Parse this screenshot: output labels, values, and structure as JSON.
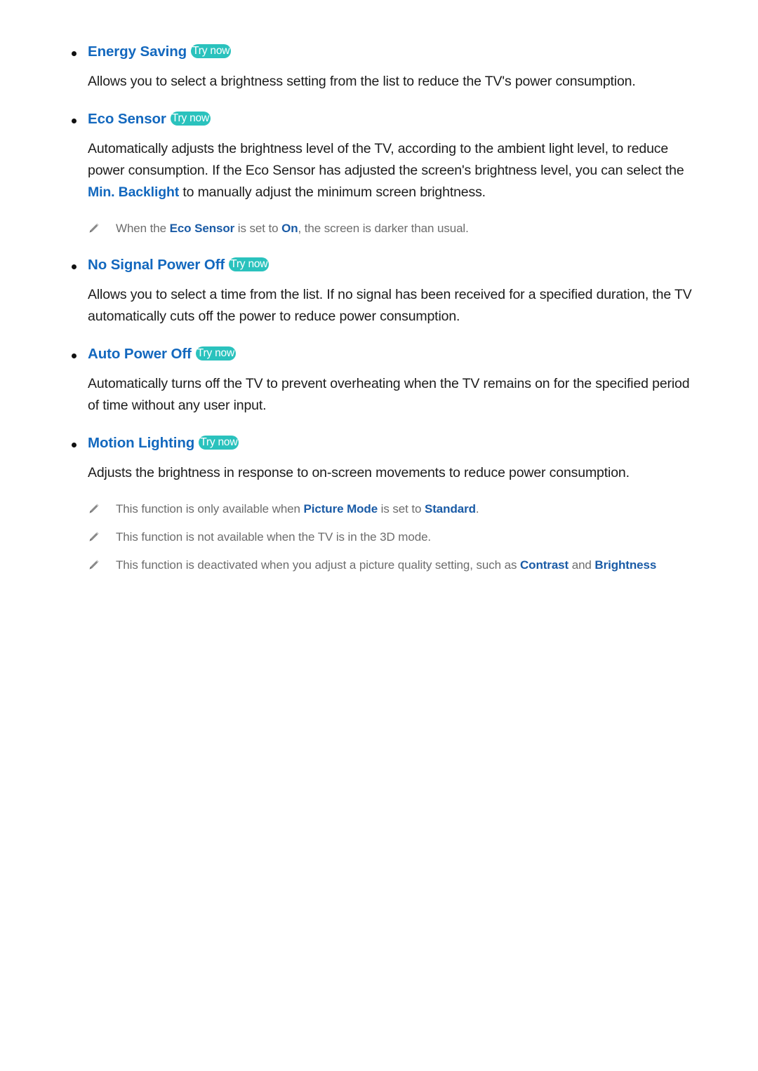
{
  "colors": {
    "heading_blue": "#1368be",
    "try_now_teal": "#2ac2bd",
    "body_text": "#1c1c1c",
    "note_text": "#6d6d6d",
    "note_bold_blue": "#1a5ba6",
    "bullet": "#111111",
    "page_background": "#ffffff"
  },
  "badges": {
    "try_now": "Try now"
  },
  "icons": {
    "pencil": "pencil-icon",
    "bullet": "bullet-dot"
  },
  "sections": [
    {
      "title": "Energy Saving",
      "badge": "Try now",
      "body_parts": [
        {
          "text": "Allows you to select a brightness setting from the list to reduce the TV's power consumption.",
          "style": "plain"
        }
      ],
      "notes": []
    },
    {
      "title": "Eco Sensor",
      "badge": "Try now",
      "body_parts": [
        {
          "text": "Automatically adjusts the brightness level of the TV, according to the ambient light level, to reduce power consumption. If the Eco Sensor has adjusted the screen's brightness level, you can select the ",
          "style": "plain"
        },
        {
          "text": "Min. Backlight",
          "style": "link"
        },
        {
          "text": " to manually adjust the minimum screen brightness.",
          "style": "plain"
        }
      ],
      "notes": [
        {
          "parts": [
            {
              "text": "When the ",
              "style": "plain"
            },
            {
              "text": "Eco Sensor",
              "style": "bold"
            },
            {
              "text": " is set to ",
              "style": "plain"
            },
            {
              "text": "On",
              "style": "bold"
            },
            {
              "text": ", the screen is darker than usual.",
              "style": "plain"
            }
          ]
        }
      ]
    },
    {
      "title": "No Signal Power Off",
      "badge": "Try now",
      "body_parts": [
        {
          "text": "Allows you to select a time from the list. If no signal has been received for a specified duration, the TV automatically cuts off the power to reduce power consumption.",
          "style": "plain"
        }
      ],
      "notes": []
    },
    {
      "title": "Auto Power Off",
      "badge": "Try now",
      "body_parts": [
        {
          "text": "Automatically turns off the TV to prevent overheating when the TV remains on for the specified period of time without any user input.",
          "style": "plain"
        }
      ],
      "notes": []
    },
    {
      "title": "Motion Lighting",
      "badge": "Try now",
      "body_parts": [
        {
          "text": "Adjusts the brightness in response to on-screen movements to reduce power consumption.",
          "style": "plain"
        }
      ],
      "notes": [
        {
          "parts": [
            {
              "text": "This function is only available when ",
              "style": "plain"
            },
            {
              "text": "Picture Mode",
              "style": "bold"
            },
            {
              "text": " is set to ",
              "style": "plain"
            },
            {
              "text": "Standard",
              "style": "bold"
            },
            {
              "text": ".",
              "style": "plain"
            }
          ]
        },
        {
          "parts": [
            {
              "text": "This function is not available when the TV is in the 3D mode.",
              "style": "plain"
            }
          ]
        },
        {
          "parts": [
            {
              "text": "This function is deactivated when you adjust a picture quality setting, such as ",
              "style": "plain"
            },
            {
              "text": "Contrast",
              "style": "bold"
            },
            {
              "text": " and ",
              "style": "plain"
            },
            {
              "text": "Brightness",
              "style": "bold"
            }
          ]
        }
      ]
    }
  ]
}
